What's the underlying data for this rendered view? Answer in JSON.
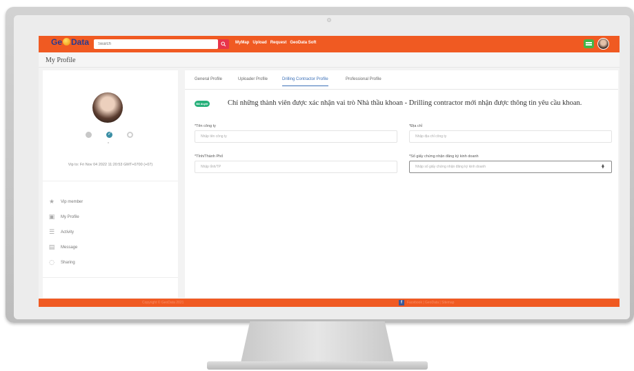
{
  "app": {
    "logo_text_1": "Ge",
    "logo_text_2": "Data",
    "brand_color": "#f05a22"
  },
  "search": {
    "placeholder": "Search"
  },
  "nav": {
    "links": [
      "MyMap",
      "Upload",
      "Request",
      "GeoData Soft"
    ]
  },
  "page": {
    "title": "My Profile"
  },
  "sidebar": {
    "vip_text": "Vip to: Fri Nov 04 2022 11:20:53 GMT+0700 (+07)",
    "items": [
      {
        "label": "Vip member",
        "icon": "star-icon"
      },
      {
        "label": "My Profile",
        "icon": "profile-icon"
      },
      {
        "label": "Activity",
        "icon": "activity-icon"
      },
      {
        "label": "Message",
        "icon": "message-icon"
      },
      {
        "label": "Sharing",
        "icon": "sharing-icon"
      }
    ]
  },
  "tabs": [
    {
      "label": "General Profile",
      "active": false
    },
    {
      "label": "Uploader Profile",
      "active": false
    },
    {
      "label": "Drilling Contractor Profile",
      "active": true
    },
    {
      "label": "Professional Profile",
      "active": false
    }
  ],
  "notice": {
    "badge": "Đã duyệt",
    "text": "Chỉ những thành viên được xác nhận vai trò Nhà thầu khoan - Drilling contractor mới nhận được thông tin yêu cầu khoan."
  },
  "form": {
    "company": {
      "label": "*Tên công ty",
      "placeholder": "Nhập tên công ty"
    },
    "address": {
      "label": "*Địa chỉ",
      "placeholder": "Nhập địa chỉ công ty"
    },
    "city": {
      "label": "*Tỉnh/Thành Phố",
      "placeholder": "Nhập tỉnh/TP"
    },
    "license": {
      "label": "*Số giấy chứng nhận đăng ký kinh doanh",
      "placeholder": "Nhập số giấy chứng nhận đăng ký kinh doanh"
    }
  },
  "footer": {
    "left_text": "Copyright © GeoData 2021",
    "right_text": "Facebook | GeoData | Sitemap"
  }
}
